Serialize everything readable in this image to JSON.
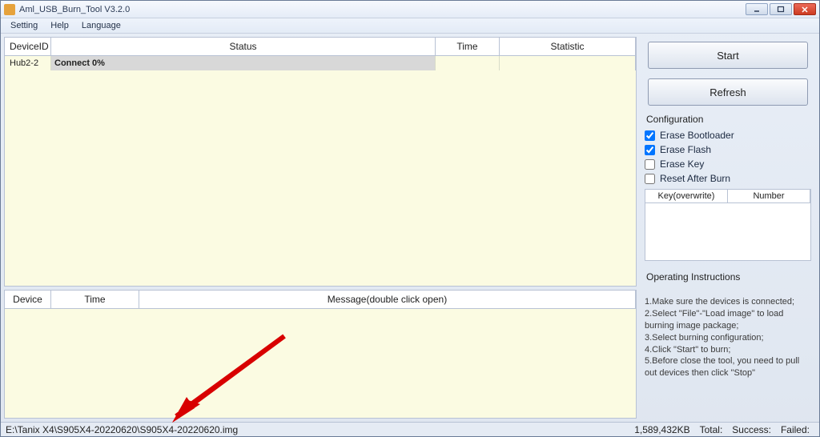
{
  "window": {
    "title": "Aml_USB_Burn_Tool V3.2.0"
  },
  "menubar": [
    "Setting",
    "Help",
    "Language"
  ],
  "top_table": {
    "headers": {
      "device": "DeviceID",
      "status": "Status",
      "time": "Time",
      "statistic": "Statistic"
    },
    "rows": [
      {
        "device": "Hub2-2",
        "status": "Connect 0%",
        "time": "",
        "statistic": ""
      }
    ]
  },
  "bottom_table": {
    "headers": {
      "device": "Device",
      "time": "Time",
      "message": "Message(double click open)"
    }
  },
  "buttons": {
    "start": "Start",
    "refresh": "Refresh"
  },
  "config": {
    "title": "Configuration",
    "options": [
      {
        "label": "Erase Bootloader",
        "checked": true
      },
      {
        "label": "Erase Flash",
        "checked": true
      },
      {
        "label": "Erase Key",
        "checked": false
      },
      {
        "label": "Reset After Burn",
        "checked": false
      }
    ],
    "key_table": {
      "headers": [
        "Key(overwrite)",
        "Number"
      ]
    }
  },
  "instructions": {
    "title": "Operating Instructions",
    "lines": [
      "1.Make sure the devices is connected;",
      "2.Select \"File\"-\"Load image\" to load burning image package;",
      "3.Select burning configuration;",
      "4.Click \"Start\" to burn;",
      "5.Before close the tool, you need to pull out devices then click \"Stop\""
    ]
  },
  "statusbar": {
    "path": "E:\\Tanix X4\\S905X4-20220620\\S905X4-20220620.img",
    "size": "1,589,432KB",
    "total_label": "Total:",
    "success_label": "Success:",
    "failed_label": "Failed:"
  }
}
